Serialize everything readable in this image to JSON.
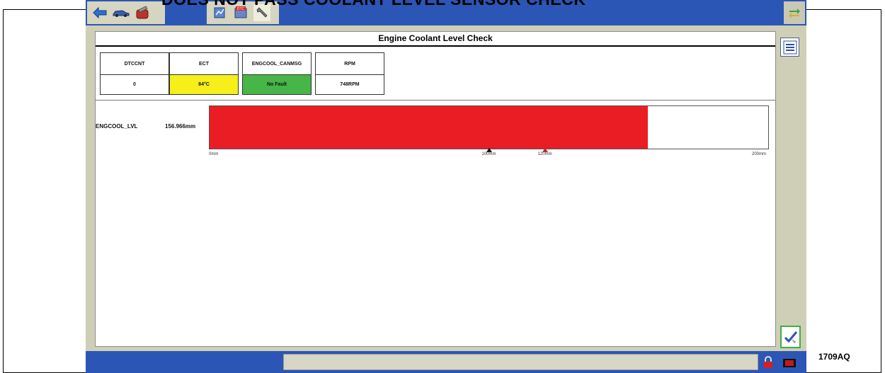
{
  "page": {
    "heading": "DOES NOT PASS COOLANT LEVEL SENSOR CHECK",
    "figure_id": "1709AQ"
  },
  "toolbar": {
    "left_icons": [
      "back-arrow-icon",
      "vehicle-icon",
      "tools-bag-icon"
    ],
    "center_icons": [
      "datalogger-icon",
      "dtc-icon",
      "wrench-icon"
    ],
    "right_icon": "swap-arrows-icon"
  },
  "panel": {
    "title": "Engine Coolant Level Check",
    "pids": [
      {
        "name": "DTCCNT",
        "value": "0",
        "bg": "#ffffff"
      },
      {
        "name": "ECT",
        "value": "84°C",
        "bg": "#f6ef1a"
      },
      {
        "name": "ENGCOOL_CANMSG",
        "value": "No Fault",
        "bg": "#47b547"
      },
      {
        "name": "RPM",
        "value": "748RPM",
        "bg": "#ffffff"
      }
    ],
    "gauge": {
      "name": "ENGCOOL_LVL",
      "value_text": "156.966mm",
      "value": 156.966,
      "min": 0,
      "max": 200,
      "unit": "mm",
      "fill_color": "#ea1c24",
      "ticks": [
        {
          "label": "0mm",
          "value": 0
        },
        {
          "label": "100mm",
          "value": 100
        },
        {
          "label": "120mm",
          "value": 120
        },
        {
          "label": "200mm",
          "value": 200
        }
      ],
      "markers": [
        100,
        120
      ]
    }
  },
  "side_buttons": [
    "list-menu-icon",
    "check-tool-icon"
  ],
  "status_icons": [
    "padlock-icon",
    "connector-icon"
  ]
}
